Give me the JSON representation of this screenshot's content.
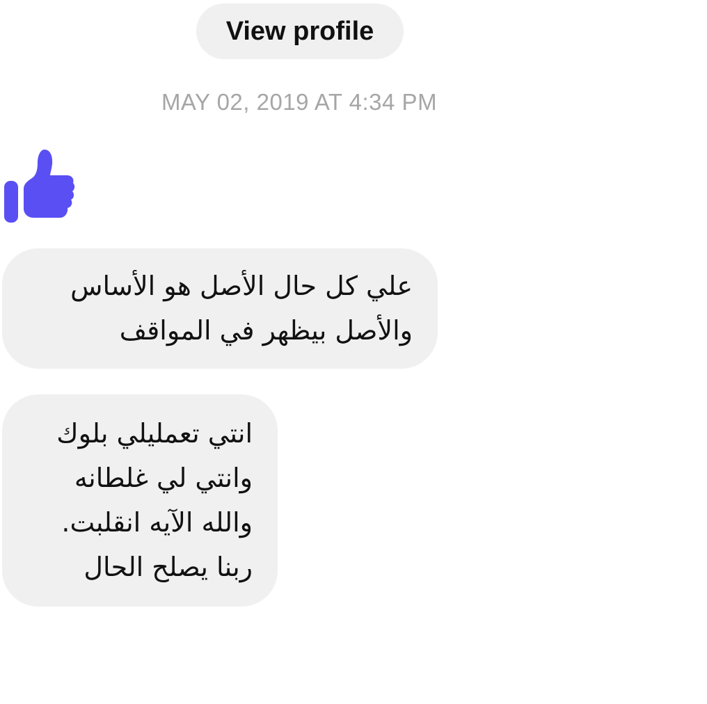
{
  "header": {
    "view_profile_label": "View profile",
    "timestamp": "MAY 02, 2019 AT 4:34 PM"
  },
  "reaction": {
    "icon": "thumbs-up-icon",
    "color": "#5a4ff3"
  },
  "messages": [
    {
      "lines": [
        "علي كل حال الأصل هو الأساس",
        "والأصل بيظهر في المواقف"
      ]
    },
    {
      "lines": [
        "انتي تعمليلي بلوك",
        "وانتي لي غلطانه",
        "والله الآيه انقلبت.",
        "ربنا يصلح الحال"
      ]
    }
  ]
}
